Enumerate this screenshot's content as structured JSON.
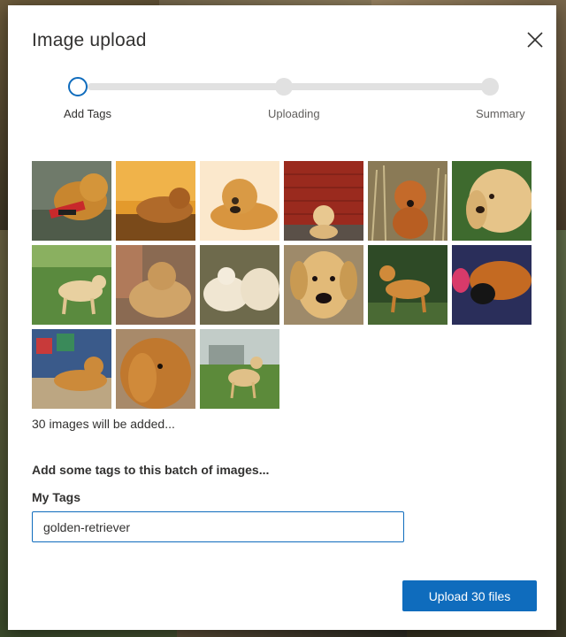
{
  "dialog": {
    "title": "Image upload",
    "close_label": "Close"
  },
  "stepper": {
    "steps": [
      {
        "label": "Add Tags",
        "state": "current"
      },
      {
        "label": "Uploading",
        "state": "pending"
      },
      {
        "label": "Summary",
        "state": "pending"
      }
    ],
    "accent_color": "#0f6cbd"
  },
  "images": {
    "thumbnails": [
      {
        "name": "golden retriever holding red toy on grass"
      },
      {
        "name": "golden retriever lying on orange blanket"
      },
      {
        "name": "golden retriever lying on cream background"
      },
      {
        "name": "golden retriever puppy by red brick wall"
      },
      {
        "name": "golden retriever standing in tall dry grass"
      },
      {
        "name": "golden retriever close-up in front of bushes"
      },
      {
        "name": "golden retriever standing on green lawn"
      },
      {
        "name": "golden retriever resting on sofa"
      },
      {
        "name": "two golden retriever puppies sleeping"
      },
      {
        "name": "golden retriever face close-up"
      },
      {
        "name": "golden retriever standing in garden"
      },
      {
        "name": "golden retriever with black cat on blue bed"
      },
      {
        "name": "golden retriever lying near gift boxes"
      },
      {
        "name": "long-haired golden retriever portrait"
      },
      {
        "name": "golden retriever standing in green field"
      }
    ],
    "count_text": "30 images will be added..."
  },
  "tags": {
    "heading": "Add some tags to this batch of images...",
    "label": "My Tags",
    "value": "golden-retriever"
  },
  "footer": {
    "upload_label": "Upload 30 files"
  }
}
